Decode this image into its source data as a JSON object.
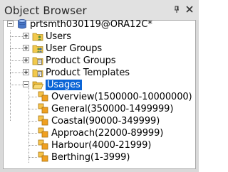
{
  "window": {
    "title": "Object Browser",
    "pin_icon": "pin-icon",
    "close_icon": "close-icon"
  },
  "tree": {
    "root": {
      "label": "prtsmth030119@ORA12C*",
      "icon": "database-icon",
      "expanded": true
    },
    "children": [
      {
        "label": "Users",
        "icon": "folder-users-icon",
        "expanded": false
      },
      {
        "label": "User Groups",
        "icon": "folder-users-icon",
        "expanded": false
      },
      {
        "label": "Product Groups",
        "icon": "folder-documents-icon",
        "expanded": false
      },
      {
        "label": "Product Templates",
        "icon": "folder-documents-icon",
        "expanded": false
      },
      {
        "label": "Usages",
        "icon": "folder-open-icon",
        "expanded": true,
        "selected": true,
        "children": [
          {
            "label": "Overview(1500000-10000000)",
            "icon": "usage-icon"
          },
          {
            "label": "General(350000-1499999)",
            "icon": "usage-icon"
          },
          {
            "label": "Coastal(90000-349999)",
            "icon": "usage-icon"
          },
          {
            "label": "Approach(22000-89999)",
            "icon": "usage-icon"
          },
          {
            "label": "Harbour(4000-21999)",
            "icon": "usage-icon"
          },
          {
            "label": "Berthing(1-3999)",
            "icon": "usage-icon"
          }
        ]
      }
    ]
  },
  "colors": {
    "selection": "#0a64d6",
    "folder": "#f2c94c",
    "database": "#4a78c8",
    "usage": "#f0a020"
  }
}
